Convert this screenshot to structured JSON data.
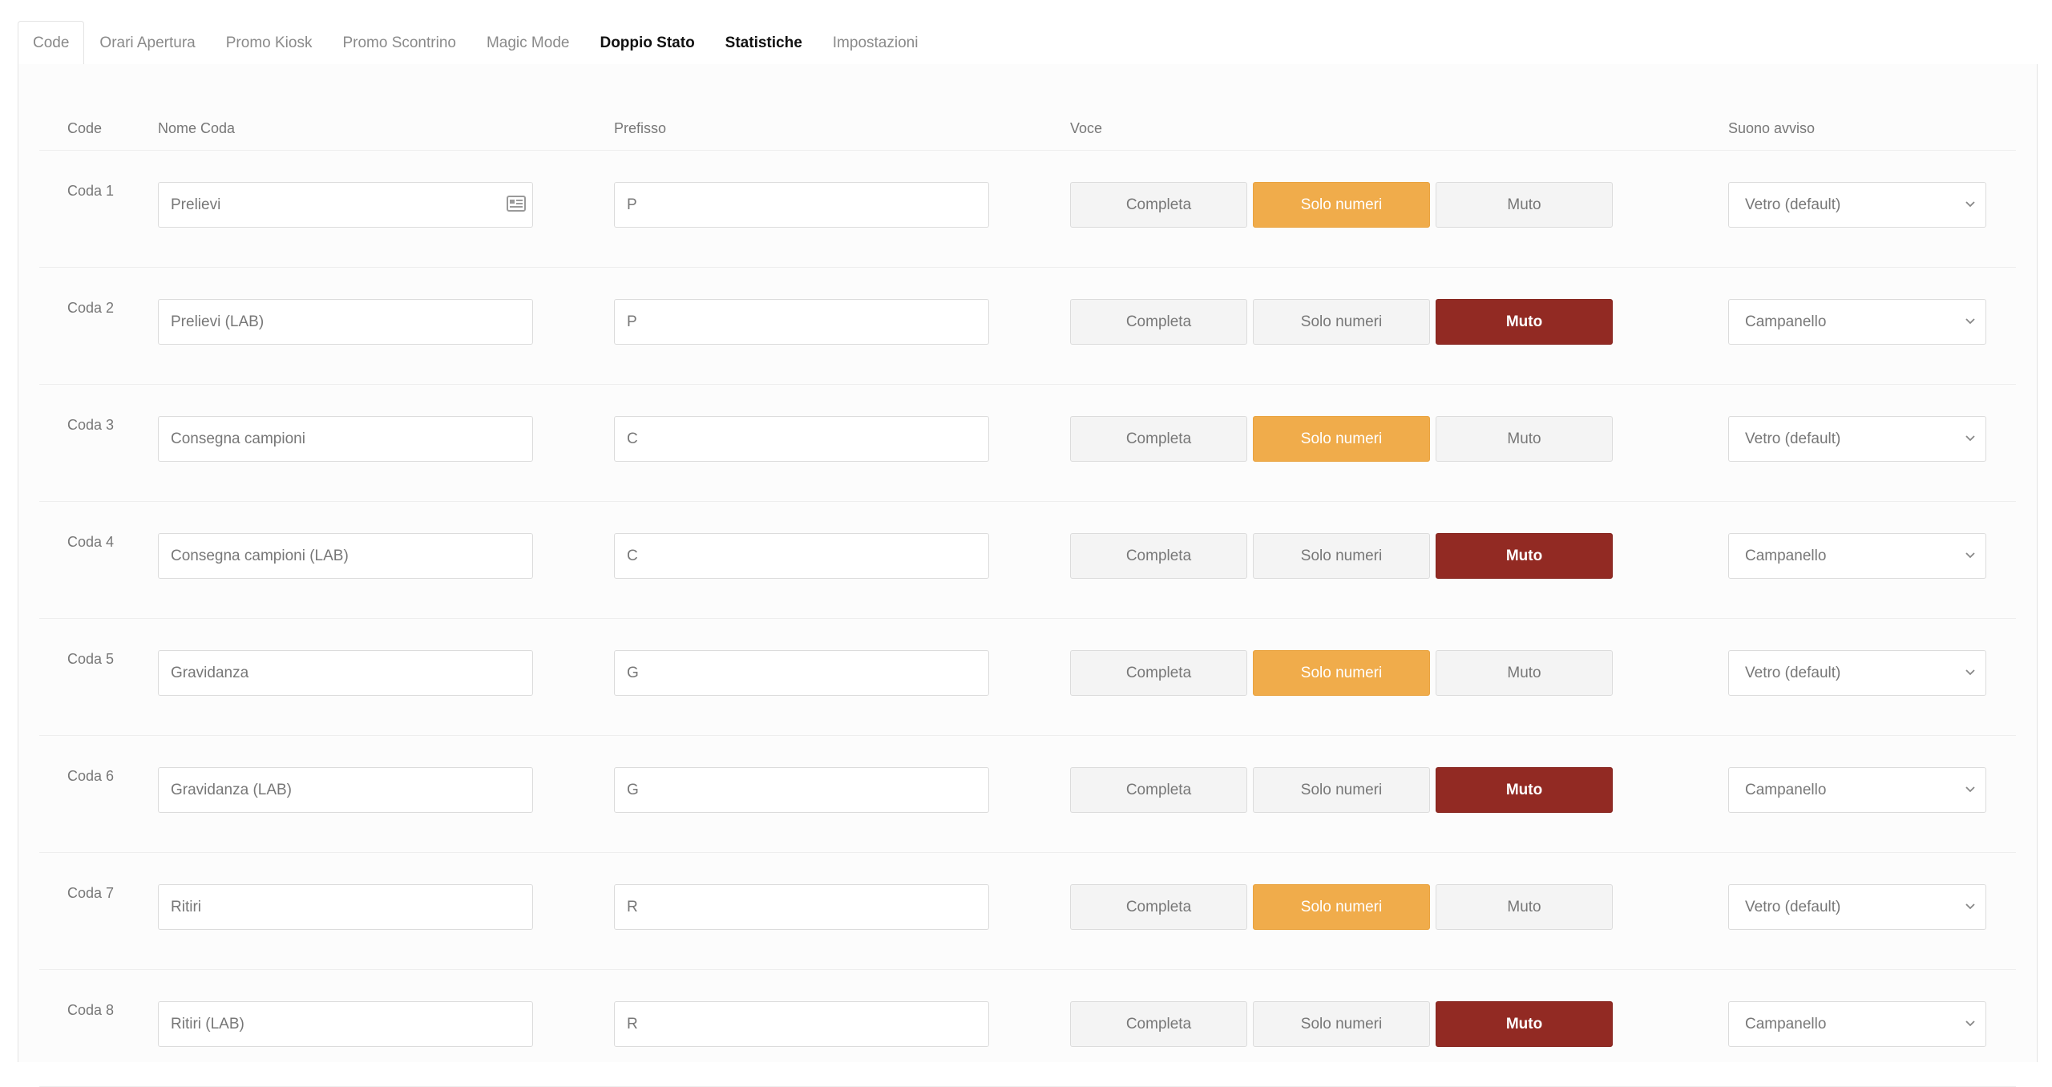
{
  "tabs": [
    {
      "label": "Code",
      "active": true,
      "bold": false
    },
    {
      "label": "Orari Apertura",
      "active": false,
      "bold": false
    },
    {
      "label": "Promo Kiosk",
      "active": false,
      "bold": false
    },
    {
      "label": "Promo Scontrino",
      "active": false,
      "bold": false
    },
    {
      "label": "Magic Mode",
      "active": false,
      "bold": false
    },
    {
      "label": "Doppio Stato",
      "active": false,
      "bold": true
    },
    {
      "label": "Statistiche",
      "active": false,
      "bold": true
    },
    {
      "label": "Impostazioni",
      "active": false,
      "bold": false
    }
  ],
  "headers": {
    "code": "Code",
    "name": "Nome Coda",
    "prefix": "Prefisso",
    "voice": "Voce",
    "sound": "Suono avviso"
  },
  "voice_options": [
    "Completa",
    "Solo numeri",
    "Muto"
  ],
  "colors": {
    "solo_numeri_active": "#f0ac4b",
    "muto_active": "#922a23"
  },
  "rows": [
    {
      "label": "Coda 1",
      "name": "Prelievi",
      "prefix": "P",
      "voice": "Solo numeri",
      "sound": "Vetro (default)",
      "card_icon": true
    },
    {
      "label": "Coda 2",
      "name": "Prelievi (LAB)",
      "prefix": "P",
      "voice": "Muto",
      "sound": "Campanello"
    },
    {
      "label": "Coda 3",
      "name": "Consegna campioni",
      "prefix": "C",
      "voice": "Solo numeri",
      "sound": "Vetro (default)"
    },
    {
      "label": "Coda 4",
      "name": "Consegna campioni (LAB)",
      "prefix": "C",
      "voice": "Muto",
      "sound": "Campanello"
    },
    {
      "label": "Coda 5",
      "name": "Gravidanza",
      "prefix": "G",
      "voice": "Solo numeri",
      "sound": "Vetro (default)"
    },
    {
      "label": "Coda 6",
      "name": "Gravidanza (LAB)",
      "prefix": "G",
      "voice": "Muto",
      "sound": "Campanello"
    },
    {
      "label": "Coda 7",
      "name": "Ritiri",
      "prefix": "R",
      "voice": "Solo numeri",
      "sound": "Vetro (default)"
    },
    {
      "label": "Coda 8",
      "name": "Ritiri (LAB)",
      "prefix": "R",
      "voice": "Muto",
      "sound": "Campanello"
    }
  ]
}
